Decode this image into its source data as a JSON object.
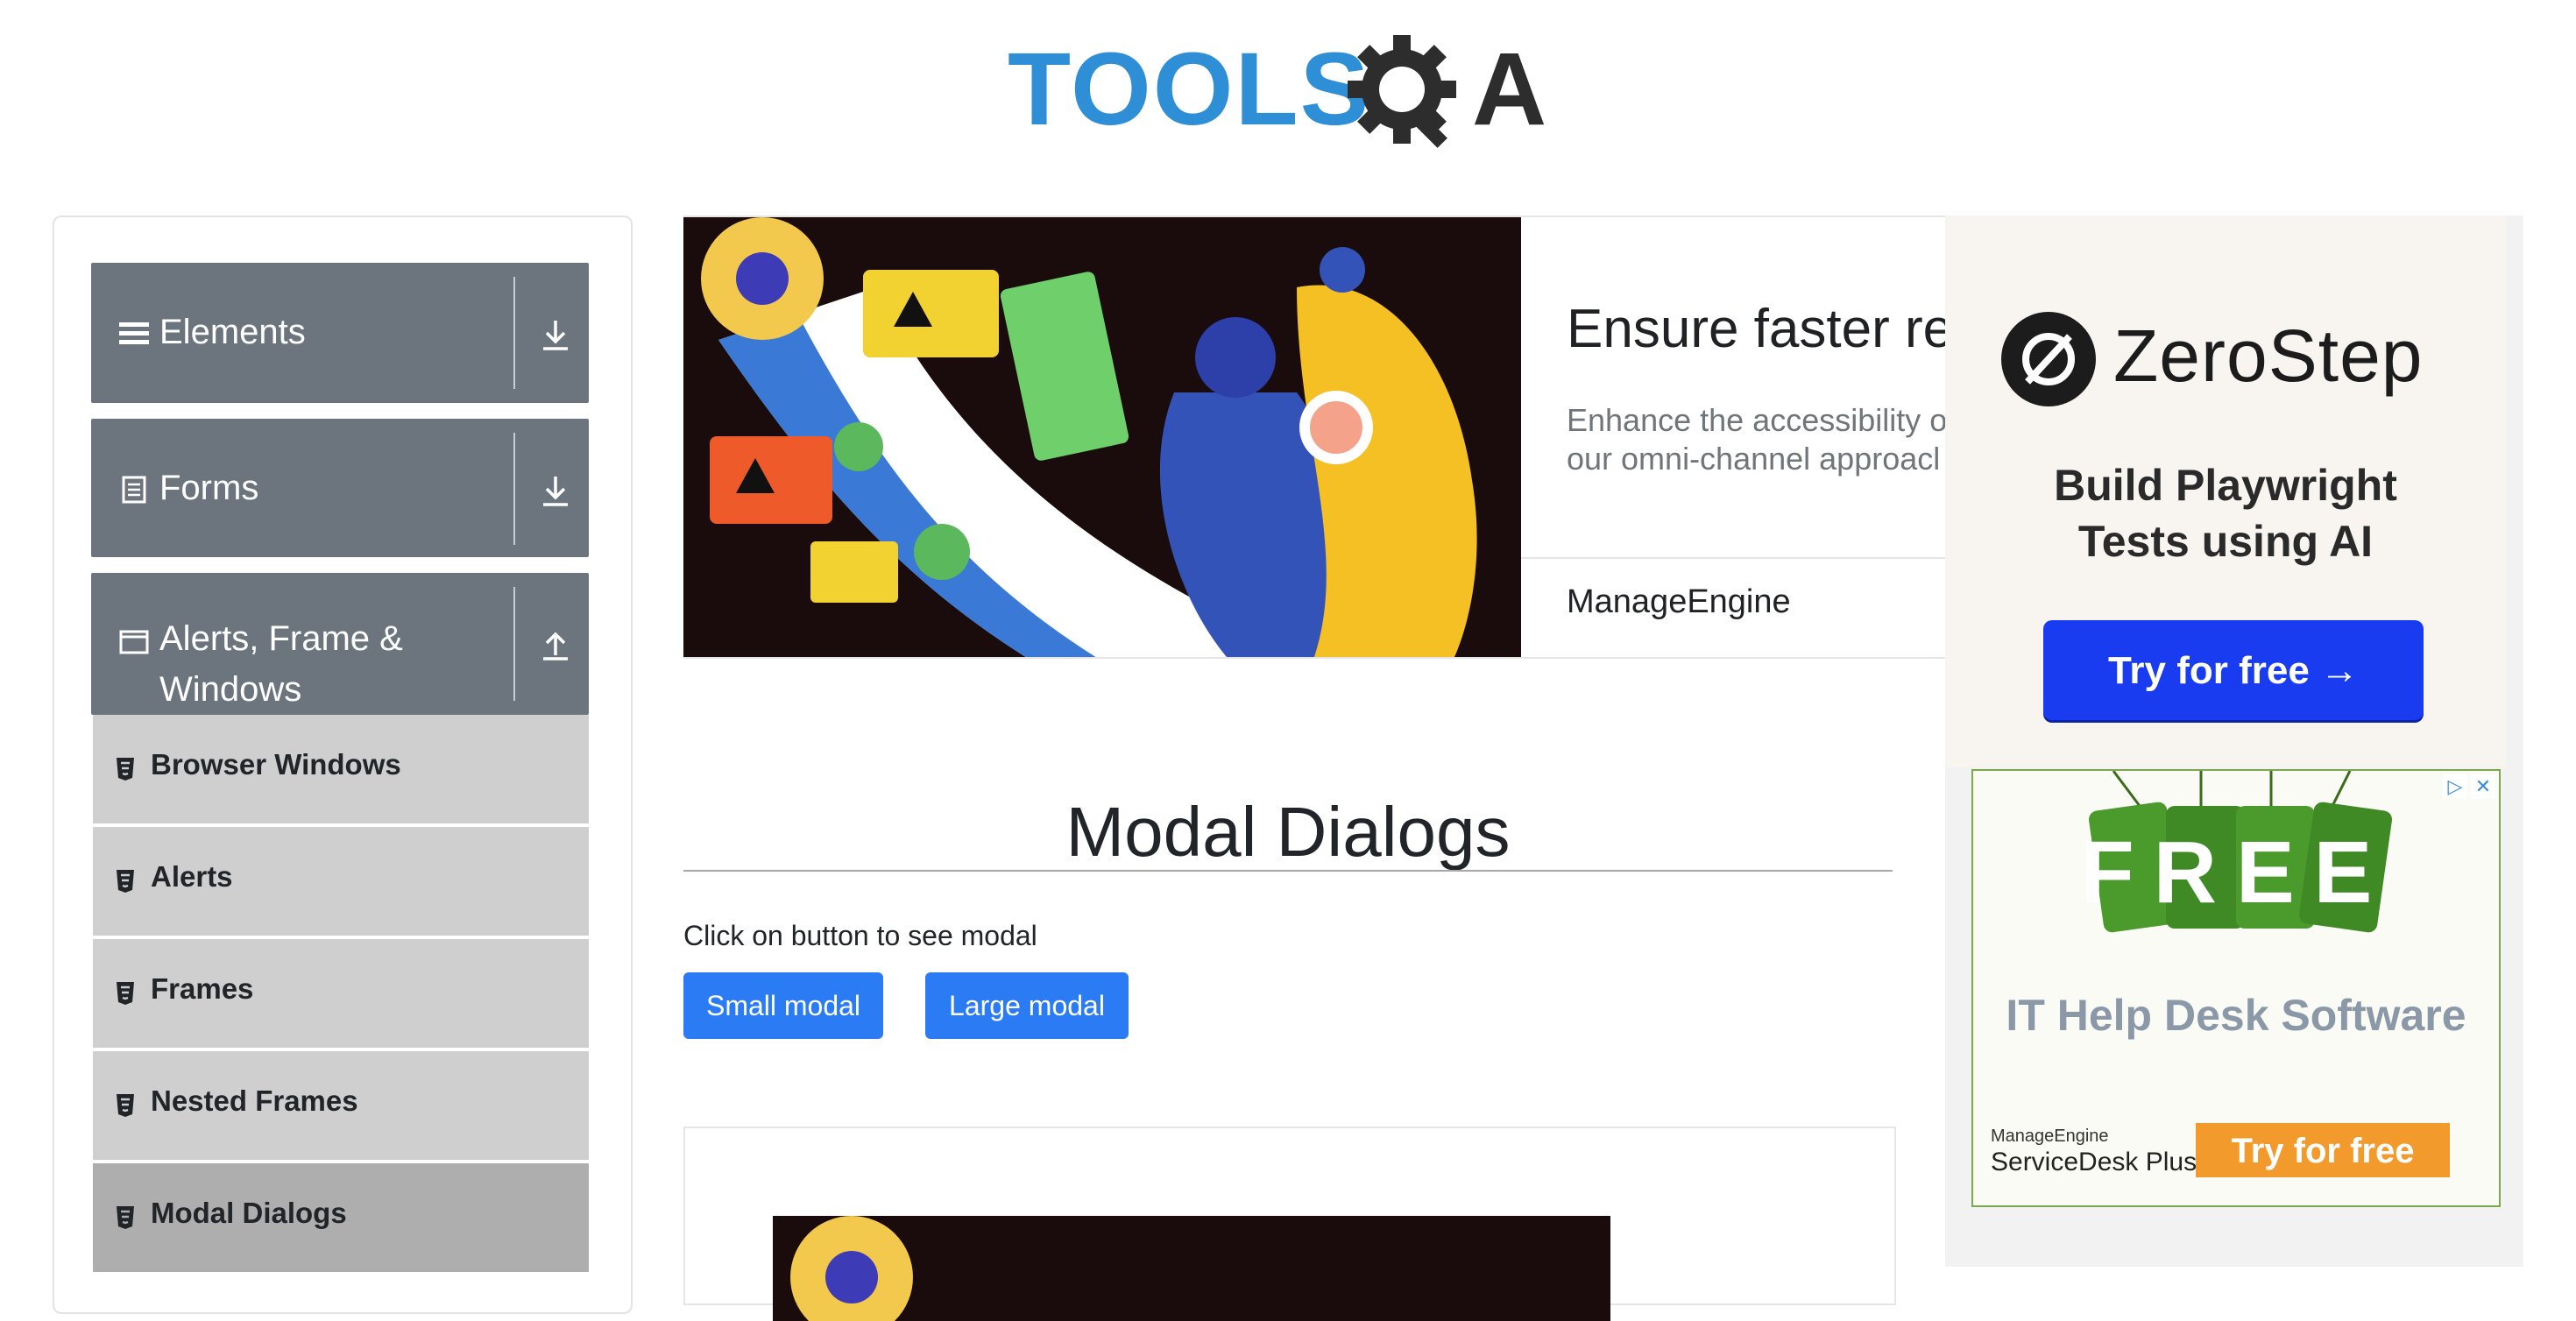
{
  "logo": {
    "text_left": "TOOLS",
    "text_right": "A"
  },
  "sidebar": {
    "groups": [
      {
        "label": "Elements",
        "icon": "hamburger-icon",
        "state": "collapsed"
      },
      {
        "label": "Forms",
        "icon": "document-icon",
        "state": "collapsed"
      },
      {
        "label": "Alerts, Frame & Windows",
        "label_line1": "Alerts, Frame &",
        "label_line2": "Windows",
        "icon": "window-icon",
        "state": "expanded"
      }
    ],
    "items": [
      {
        "label": "Browser Windows",
        "icon": "html5-icon",
        "active": false
      },
      {
        "label": "Alerts",
        "icon": "html5-icon",
        "active": false
      },
      {
        "label": "Frames",
        "icon": "html5-icon",
        "active": false
      },
      {
        "label": "Nested Frames",
        "icon": "html5-icon",
        "active": false
      },
      {
        "label": "Modal Dialogs",
        "icon": "html5-icon",
        "active": true
      }
    ]
  },
  "top_ad": {
    "headline": "Ensure faster res",
    "body_line1": "Enhance the accessibility o",
    "body_line2": "our omni-channel approacl",
    "brand": "ManageEngine"
  },
  "main": {
    "title": "Modal Dialogs",
    "instruction": "Click on button to see modal",
    "small_modal_label": "Small modal",
    "large_modal_label": "Large modal"
  },
  "right_ad_zerostep": {
    "name": "ZeroStep",
    "tagline_line1": "Build Playwright",
    "tagline_line2": "Tests using AI",
    "cta": "Try for free →"
  },
  "right_ad_manageengine": {
    "badge_text": "FREE",
    "headline": "IT Help Desk Software",
    "brand_small": "ManageEngine",
    "brand": "ServiceDesk Plus",
    "cta": "Try for free"
  },
  "colors": {
    "sidebar_header": "#6c757d",
    "submenu": "#cfcfcf",
    "submenu_active": "#aeaeae",
    "primary_button": "#2b7bf5",
    "logo_blue": "#2f8fd6",
    "zerostep_cta": "#1a3cf0",
    "manageengine_cta": "#f39a2c"
  }
}
